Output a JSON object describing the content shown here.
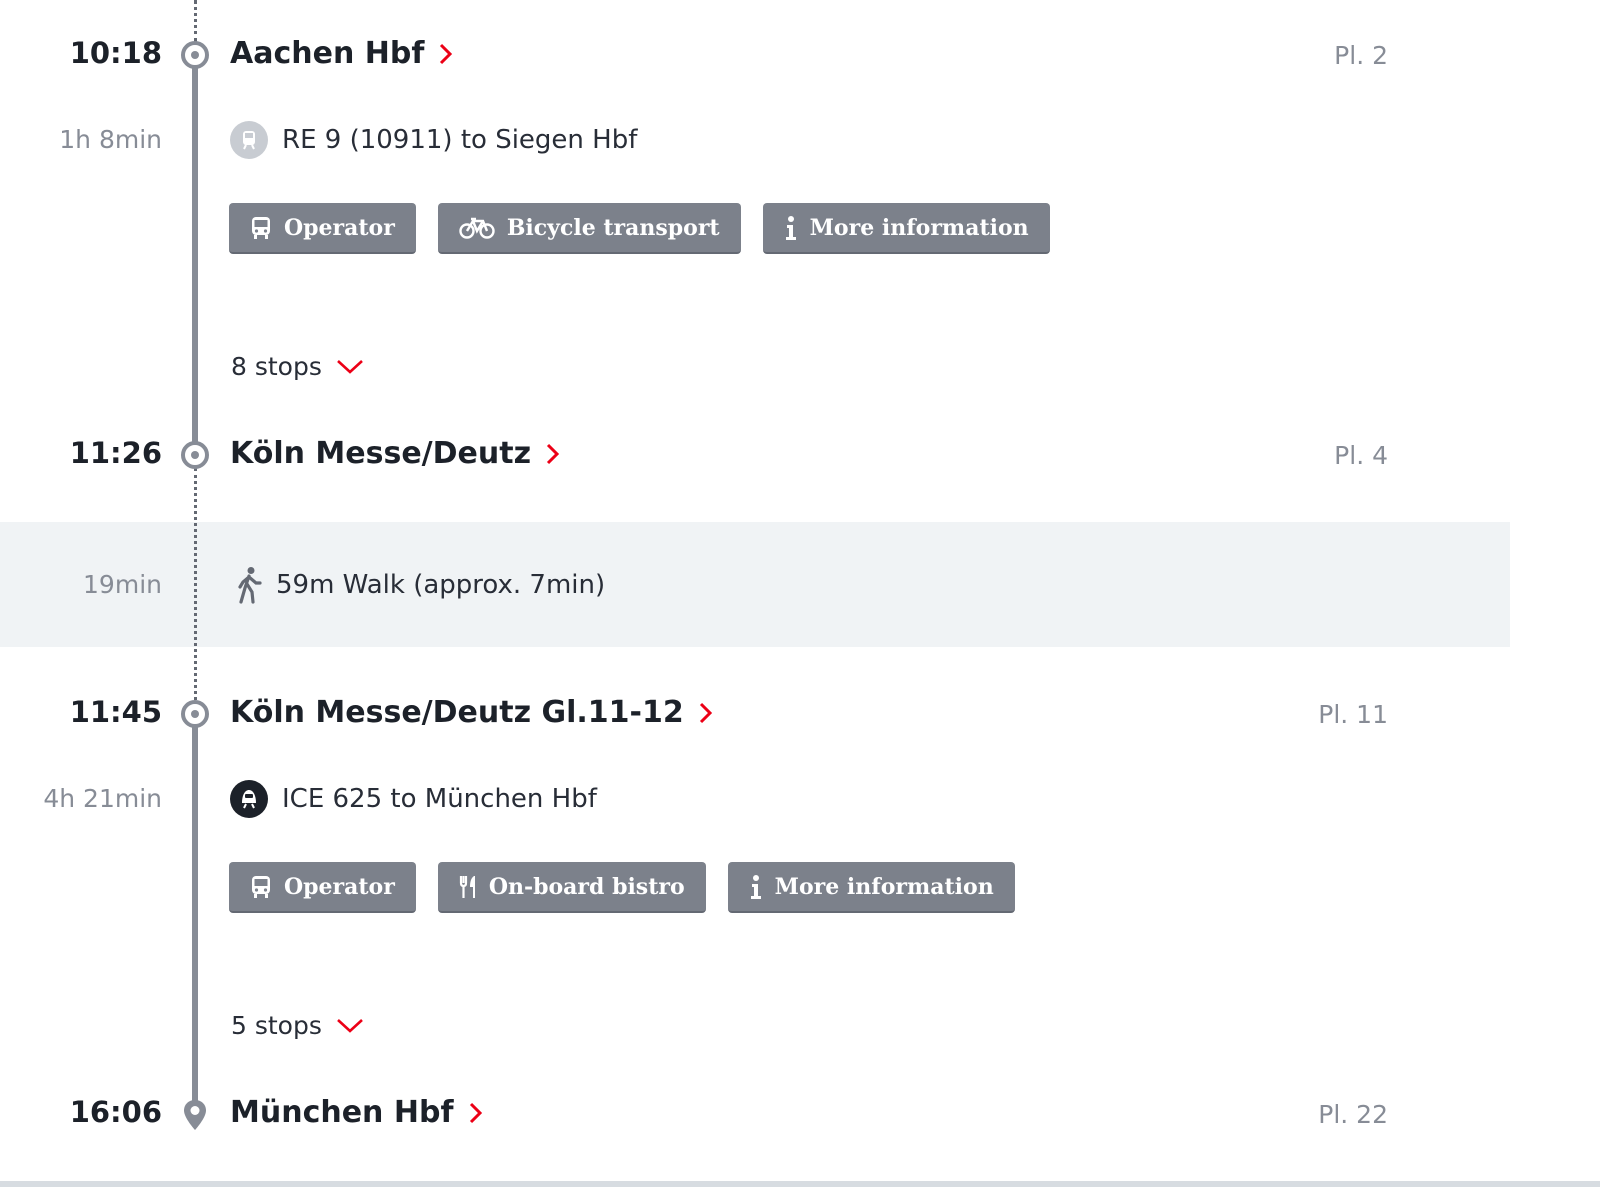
{
  "journey": {
    "stops": [
      {
        "time": "10:18",
        "station": "Aachen Hbf",
        "platform": "Pl. 2"
      },
      {
        "time": "11:26",
        "station": "Köln Messe/Deutz",
        "platform": "Pl. 4"
      },
      {
        "time": "11:45",
        "station": "Köln Messe/Deutz Gl.11-12",
        "platform": "Pl. 11"
      },
      {
        "time": "16:06",
        "station": "München Hbf",
        "platform": "Pl. 22"
      }
    ],
    "legs": [
      {
        "duration": "1h 8min",
        "train": "RE 9 (10911) to Siegen Hbf",
        "train_icon": "regional-train-icon",
        "buttons": [
          {
            "label": "Operator",
            "icon": "bus-icon"
          },
          {
            "label": "Bicycle transport",
            "icon": "bicycle-icon"
          },
          {
            "label": "More information",
            "icon": "info-icon"
          }
        ],
        "stops_toggle": "8 stops"
      },
      {
        "duration": "4h 21min",
        "train": "ICE 625 to München Hbf",
        "train_icon": "ice-train-icon",
        "buttons": [
          {
            "label": "Operator",
            "icon": "bus-icon"
          },
          {
            "label": "On-board bistro",
            "icon": "cutlery-icon"
          },
          {
            "label": "More information",
            "icon": "info-icon"
          }
        ],
        "stops_toggle": "5 stops"
      }
    ],
    "transfer": {
      "duration": "19min",
      "walk": "59m Walk (approx. 7min)",
      "icon": "walking-person-icon"
    }
  },
  "colors": {
    "accent_red": "#ec0016",
    "button_gray": "#7c818b",
    "timeline_gray": "#878c96",
    "walk_background": "#f0f3f5",
    "text_dark": "#1c2129"
  }
}
